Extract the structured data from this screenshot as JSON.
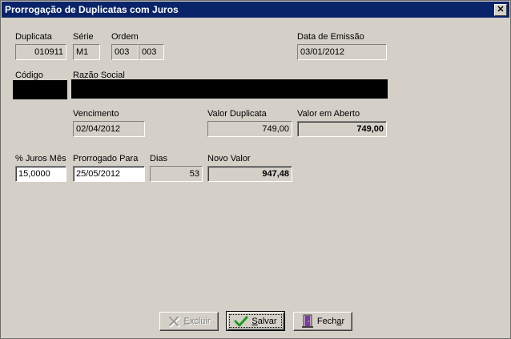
{
  "window": {
    "title": "Prorrogação de Duplicatas com Juros",
    "close_symbol": "✕"
  },
  "labels": {
    "duplicata": "Duplicata",
    "serie": "Série",
    "ordem": "Ordem",
    "data_emissao": "Data de Emissão",
    "codigo": "Código",
    "razao_social": "Razão Social",
    "vencimento": "Vencimento",
    "valor_duplicata": "Valor Duplicata",
    "valor_aberto": "Valor em Aberto",
    "juros_mes": "% Juros Mês",
    "prorrogado_para": "Prorrogado Para",
    "dias": "Dias",
    "novo_valor": "Novo Valor"
  },
  "values": {
    "duplicata": "010911",
    "serie": "M1",
    "ordem_1": "003",
    "ordem_2": "003",
    "data_emissao": "03/01/2012",
    "codigo": "",
    "razao_social": "",
    "vencimento": "02/04/2012",
    "valor_duplicata": "749,00",
    "valor_aberto": "749,00",
    "juros_mes": "15,0000",
    "prorrogado_para": "25/05/2012",
    "dias": "53",
    "novo_valor": "947,48"
  },
  "buttons": {
    "excluir": {
      "prefix": "",
      "accel": "E",
      "rest": "xcluir",
      "icon": "delete-x-icon",
      "enabled": false
    },
    "salvar": {
      "prefix": "",
      "accel": "S",
      "rest": "alvar",
      "icon": "checkmark-icon",
      "enabled": true
    },
    "fechar": {
      "prefix": "Fech",
      "accel": "a",
      "rest": "r",
      "icon": "door-exit-icon",
      "enabled": true
    }
  },
  "colors": {
    "titlebar": "#0a246a",
    "face": "#d4d0c8",
    "check": "#1e9a1e",
    "door": "#7a3aa0"
  }
}
